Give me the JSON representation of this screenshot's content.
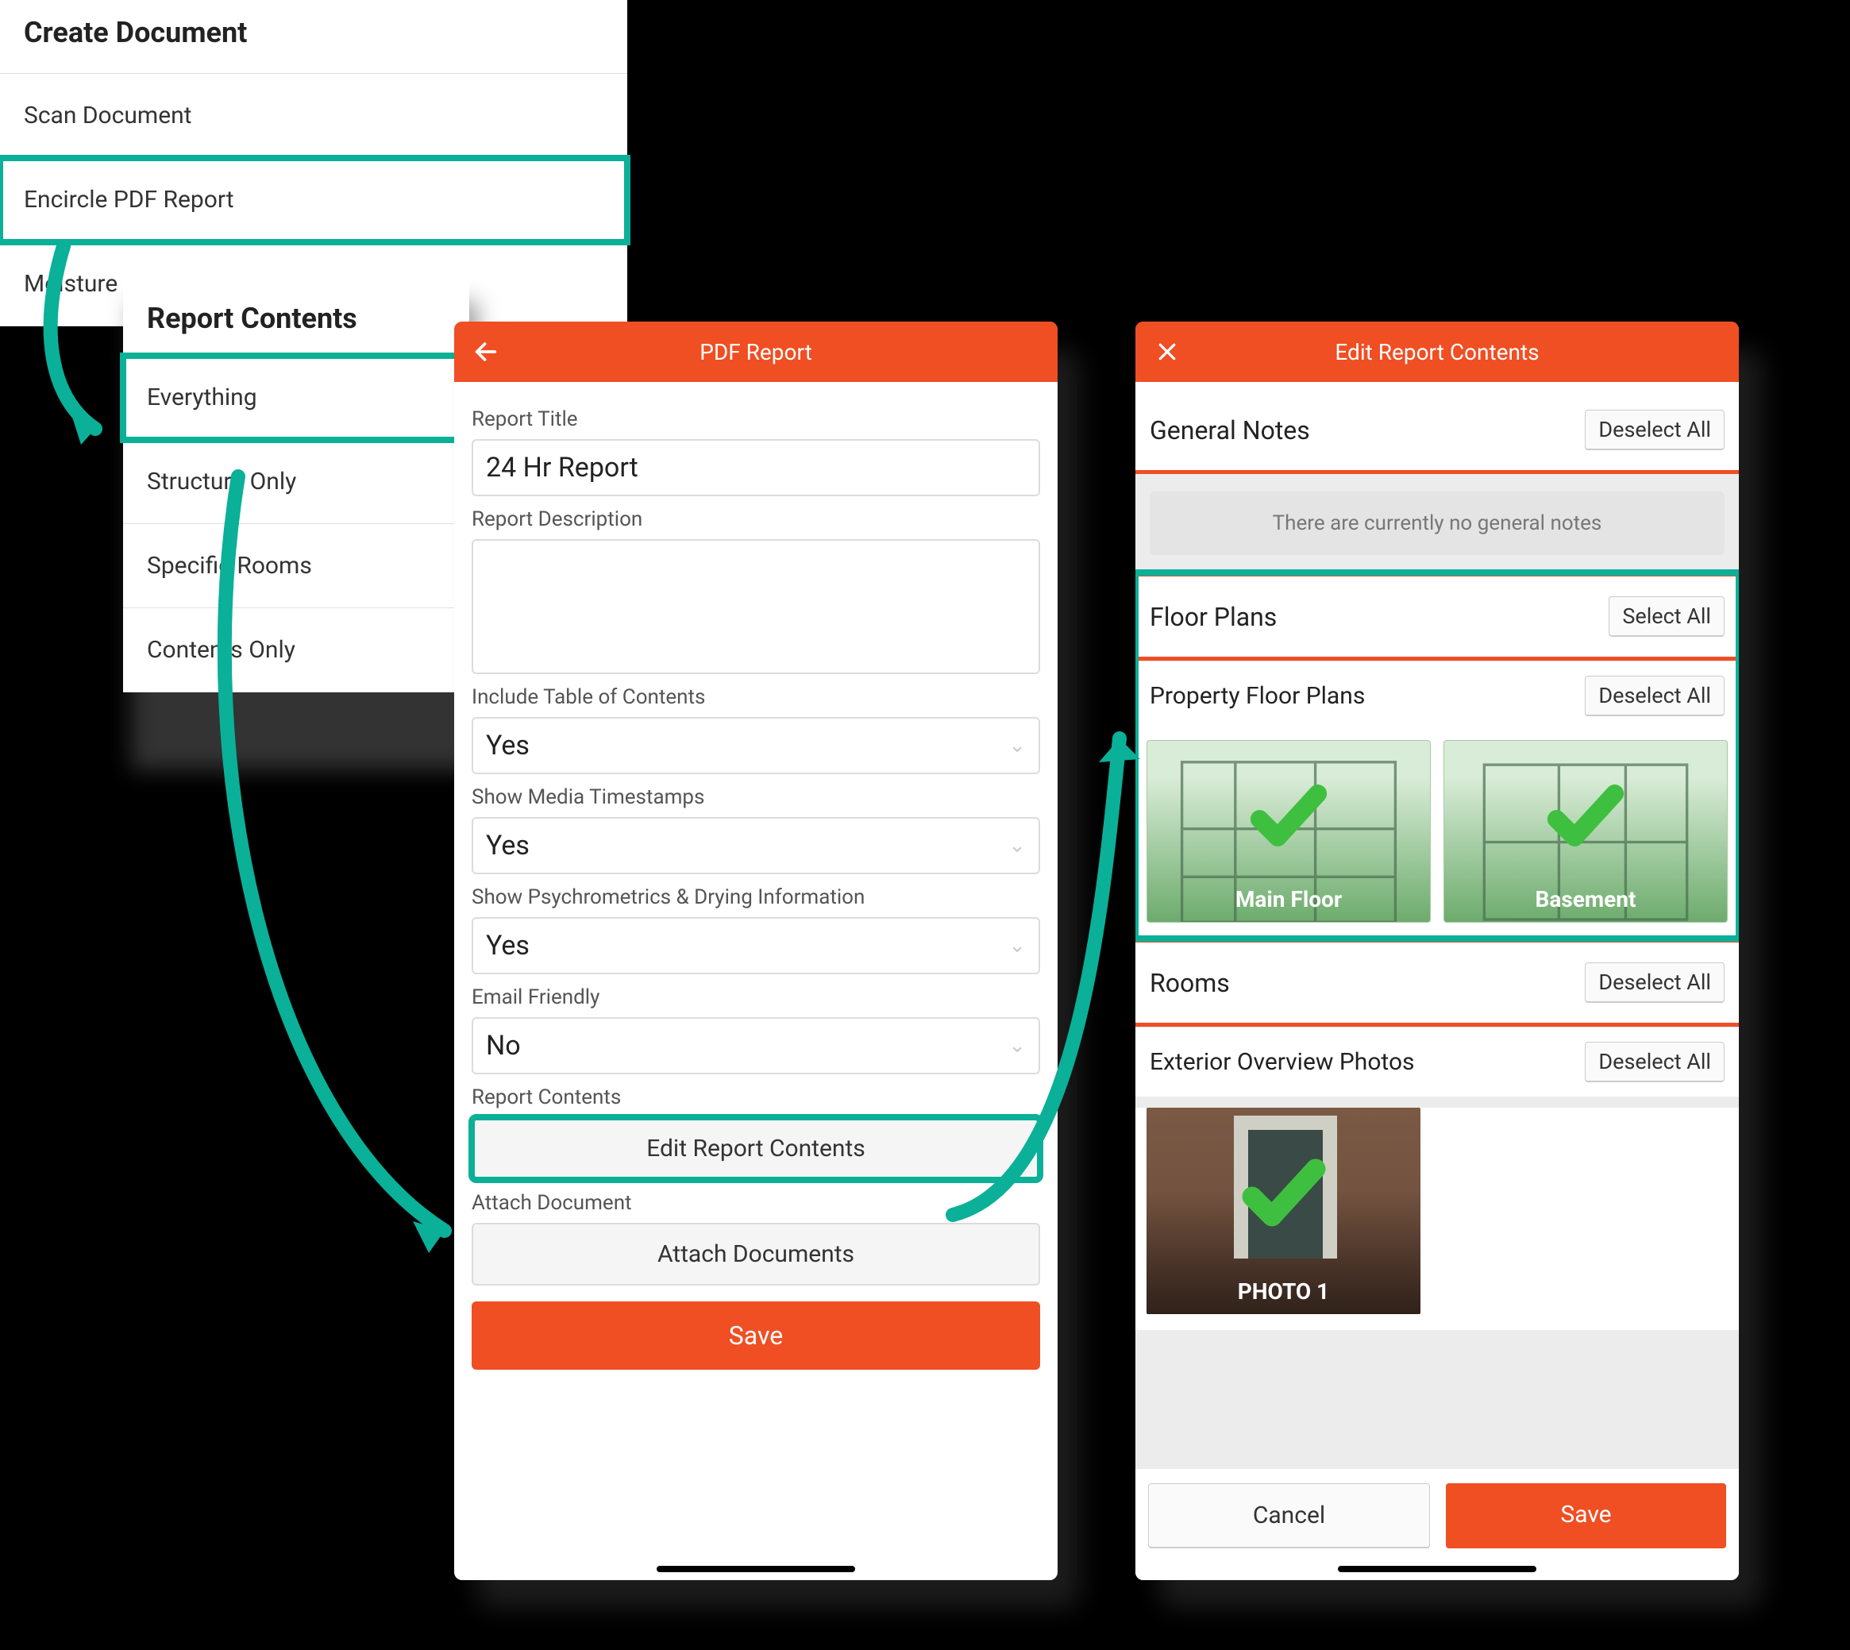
{
  "panel1": {
    "title": "Create Document",
    "items": [
      "Scan Document",
      "Encircle PDF Report",
      "Moisture"
    ]
  },
  "panel2": {
    "title": "Report Contents",
    "items": [
      "Everything",
      "Structure Only",
      "Specific Rooms",
      "Contents Only"
    ]
  },
  "pdfReport": {
    "headerTitle": "PDF Report",
    "reportTitle": {
      "label": "Report Title",
      "value": "24 Hr Report"
    },
    "reportDescription": {
      "label": "Report Description",
      "value": ""
    },
    "includeToc": {
      "label": "Include Table of Contents",
      "value": "Yes"
    },
    "showTimestamps": {
      "label": "Show Media Timestamps",
      "value": "Yes"
    },
    "showPsych": {
      "label": "Show Psychrometrics & Drying Information",
      "value": "Yes"
    },
    "emailFriendly": {
      "label": "Email Friendly",
      "value": "No"
    },
    "reportContents": {
      "label": "Report Contents",
      "button": "Edit Report Contents"
    },
    "attachDocument": {
      "label": "Attach Document",
      "button": "Attach Documents"
    },
    "save": "Save"
  },
  "editContents": {
    "headerTitle": "Edit Report Contents",
    "generalNotes": {
      "title": "General Notes",
      "action": "Deselect All",
      "empty": "There are currently no general notes"
    },
    "floorPlans": {
      "title": "Floor Plans",
      "action": "Select All",
      "subTitle": "Property Floor Plans",
      "subAction": "Deselect All",
      "thumbs": [
        "Main Floor",
        "Basement"
      ]
    },
    "rooms": {
      "title": "Rooms",
      "action": "Deselect All"
    },
    "exteriorPhotos": {
      "title": "Exterior Overview Photos",
      "action": "Deselect All",
      "thumbs": [
        "PHOTO 1"
      ]
    },
    "cancel": "Cancel",
    "save": "Save"
  },
  "colors": {
    "accent": "#f04e23",
    "teal": "#0ab098",
    "check": "#3fbf3f"
  }
}
